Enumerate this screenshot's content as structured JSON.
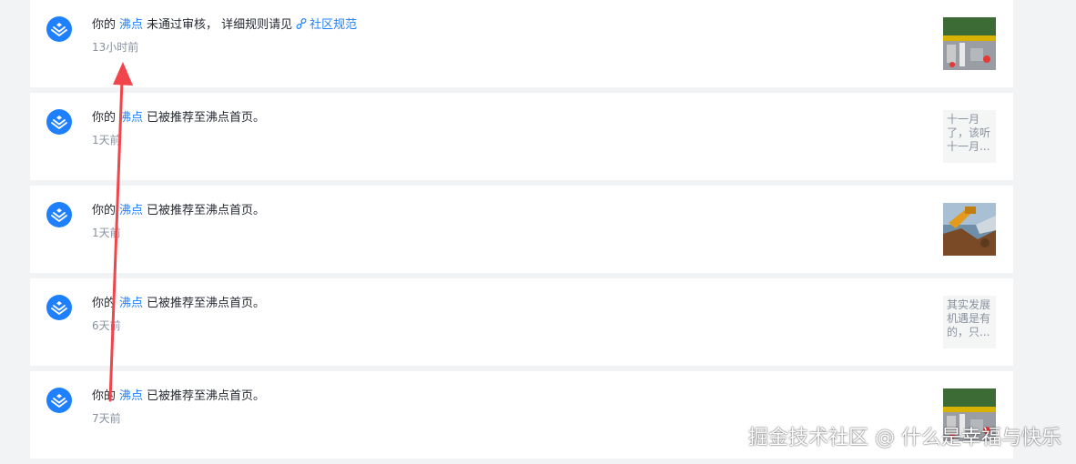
{
  "notifications": [
    {
      "prefix": "你的",
      "link": "沸点",
      "text": "未通过审核， 详细规则请见",
      "extra_link": "社区规范",
      "time": "13小时前",
      "thumb": {
        "kind": "photo-street"
      }
    },
    {
      "prefix": "你的",
      "link": "沸点",
      "text": "已被推荐至沸点首页。",
      "time": "1天前",
      "thumb": {
        "kind": "text",
        "text": "十一月了，该听十一月..."
      }
    },
    {
      "prefix": "你的",
      "link": "沸点",
      "text": "已被推荐至沸点首页。",
      "time": "1天前",
      "thumb": {
        "kind": "photo-excavator"
      }
    },
    {
      "prefix": "你的",
      "link": "沸点",
      "text": "已被推荐至沸点首页。",
      "time": "6天前",
      "thumb": {
        "kind": "text",
        "text": "其实发展机遇是有的，只..."
      }
    },
    {
      "prefix": "你的",
      "link": "沸点",
      "text": "已被推荐至沸点首页。",
      "time": "7天前",
      "thumb": {
        "kind": "photo-street"
      }
    }
  ],
  "watermark": "掘金技术社区 @ 什么是幸福与快乐",
  "colors": {
    "accent": "#1e80ff",
    "arrow": "#f0454b",
    "background": "#f2f3f5"
  },
  "icons": {
    "avatar": "juejin-logo-icon",
    "link": "chain-link-icon"
  }
}
